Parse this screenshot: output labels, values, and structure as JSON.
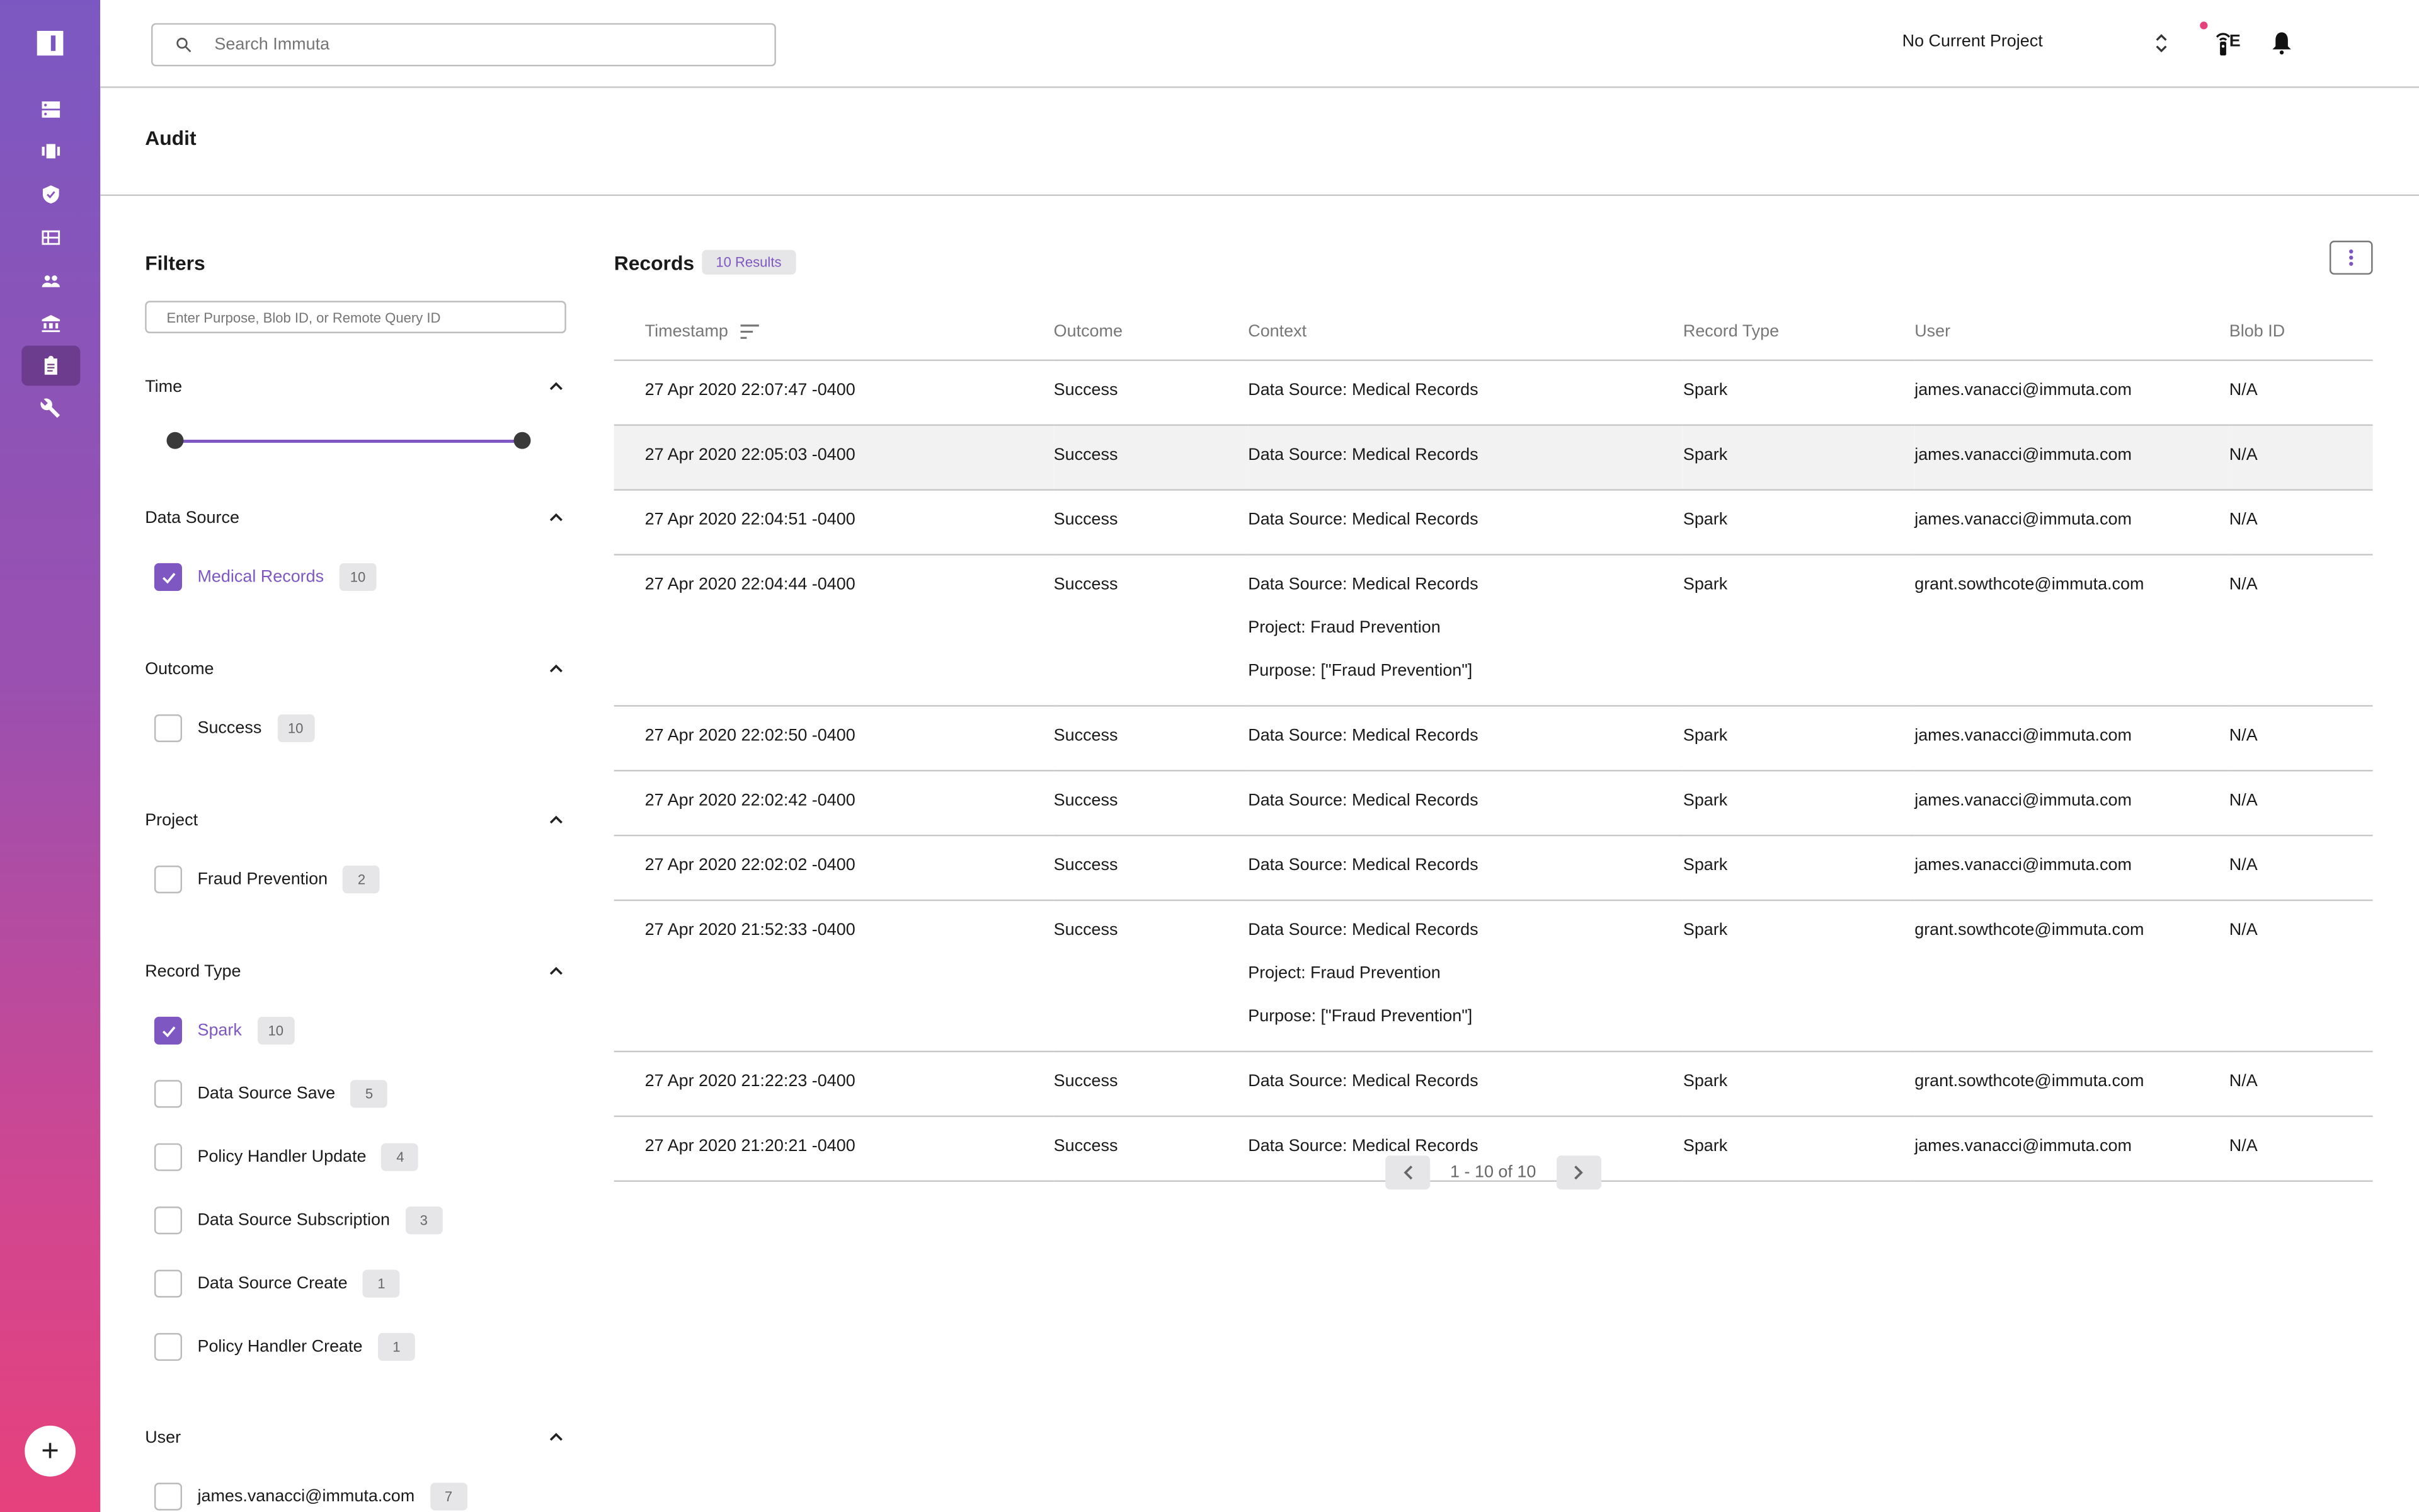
{
  "app": {
    "name": "Immuta"
  },
  "sidebar": {
    "items": [
      {
        "name": "data-sources-icon"
      },
      {
        "name": "projects-icon"
      },
      {
        "name": "policies-icon"
      },
      {
        "name": "catalog-icon"
      },
      {
        "name": "people-icon"
      },
      {
        "name": "governance-icon"
      },
      {
        "name": "audit-icon",
        "active": true
      },
      {
        "name": "tools-icon"
      }
    ],
    "fab_label": "+"
  },
  "topbar": {
    "search_placeholder": "Search Immuta",
    "project_label": "No Current Project",
    "avatar_initial": "E",
    "notification_badge_color": "#e6417c"
  },
  "page": {
    "title": "Audit"
  },
  "filters": {
    "title": "Filters",
    "input_placeholder": "Enter Purpose, Blob ID, or Remote Query ID",
    "time": {
      "title": "Time",
      "range_start_fraction": 0,
      "range_end_fraction": 1
    },
    "sections": [
      {
        "title": "Data Source",
        "options": [
          {
            "label": "Medical Records",
            "count": "10",
            "checked": true
          }
        ]
      },
      {
        "title": "Outcome",
        "options": [
          {
            "label": "Success",
            "count": "10",
            "checked": false
          }
        ]
      },
      {
        "title": "Project",
        "options": [
          {
            "label": "Fraud Prevention",
            "count": "2",
            "checked": false
          }
        ]
      },
      {
        "title": "Record Type",
        "options": [
          {
            "label": "Spark",
            "count": "10",
            "checked": true
          },
          {
            "label": "Data Source Save",
            "count": "5",
            "checked": false
          },
          {
            "label": "Policy Handler Update",
            "count": "4",
            "checked": false
          },
          {
            "label": "Data Source Subscription",
            "count": "3",
            "checked": false
          },
          {
            "label": "Data Source Create",
            "count": "1",
            "checked": false
          },
          {
            "label": "Policy Handler Create",
            "count": "1",
            "checked": false
          }
        ]
      },
      {
        "title": "User",
        "options": [
          {
            "label": "james.vanacci@immuta.com",
            "count": "7",
            "checked": false
          }
        ]
      }
    ]
  },
  "records": {
    "title": "Records",
    "results_badge": "10 Results",
    "columns": [
      "Timestamp",
      "Outcome",
      "Context",
      "Record Type",
      "User",
      "Blob ID"
    ],
    "rows": [
      {
        "timestamp": "27 Apr 2020 22:07:47 -0400",
        "outcome": "Success",
        "context": [
          "Data Source: Medical Records"
        ],
        "record_type": "Spark",
        "user": "james.vanacci@immuta.com",
        "blob_id": "N/A"
      },
      {
        "timestamp": "27 Apr 2020 22:05:03 -0400",
        "outcome": "Success",
        "context": [
          "Data Source: Medical Records"
        ],
        "record_type": "Spark",
        "user": "james.vanacci@immuta.com",
        "blob_id": "N/A",
        "hover": true
      },
      {
        "timestamp": "27 Apr 2020 22:04:51 -0400",
        "outcome": "Success",
        "context": [
          "Data Source: Medical Records"
        ],
        "record_type": "Spark",
        "user": "james.vanacci@immuta.com",
        "blob_id": "N/A"
      },
      {
        "timestamp": "27 Apr 2020 22:04:44 -0400",
        "outcome": "Success",
        "context": [
          "Data Source: Medical Records",
          "Project: Fraud Prevention",
          "Purpose: [\"Fraud Prevention\"]"
        ],
        "record_type": "Spark",
        "user": "grant.sowthcote@immuta.com",
        "blob_id": "N/A"
      },
      {
        "timestamp": "27 Apr 2020 22:02:50 -0400",
        "outcome": "Success",
        "context": [
          "Data Source: Medical Records"
        ],
        "record_type": "Spark",
        "user": "james.vanacci@immuta.com",
        "blob_id": "N/A"
      },
      {
        "timestamp": "27 Apr 2020 22:02:42 -0400",
        "outcome": "Success",
        "context": [
          "Data Source: Medical Records"
        ],
        "record_type": "Spark",
        "user": "james.vanacci@immuta.com",
        "blob_id": "N/A"
      },
      {
        "timestamp": "27 Apr 2020 22:02:02 -0400",
        "outcome": "Success",
        "context": [
          "Data Source: Medical Records"
        ],
        "record_type": "Spark",
        "user": "james.vanacci@immuta.com",
        "blob_id": "N/A"
      },
      {
        "timestamp": "27 Apr 2020 21:52:33 -0400",
        "outcome": "Success",
        "context": [
          "Data Source: Medical Records",
          "Project: Fraud Prevention",
          "Purpose: [\"Fraud Prevention\"]"
        ],
        "record_type": "Spark",
        "user": "grant.sowthcote@immuta.com",
        "blob_id": "N/A"
      },
      {
        "timestamp": "27 Apr 2020 21:22:23 -0400",
        "outcome": "Success",
        "context": [
          "Data Source: Medical Records"
        ],
        "record_type": "Spark",
        "user": "grant.sowthcote@immuta.com",
        "blob_id": "N/A"
      },
      {
        "timestamp": "27 Apr 2020 21:20:21 -0400",
        "outcome": "Success",
        "context": [
          "Data Source: Medical Records"
        ],
        "record_type": "Spark",
        "user": "james.vanacci@immuta.com",
        "blob_id": "N/A"
      }
    ],
    "pagination": {
      "label": "1 - 10 of 10"
    }
  },
  "colors": {
    "accent": "#7e57c2",
    "pink": "#e6417c"
  }
}
